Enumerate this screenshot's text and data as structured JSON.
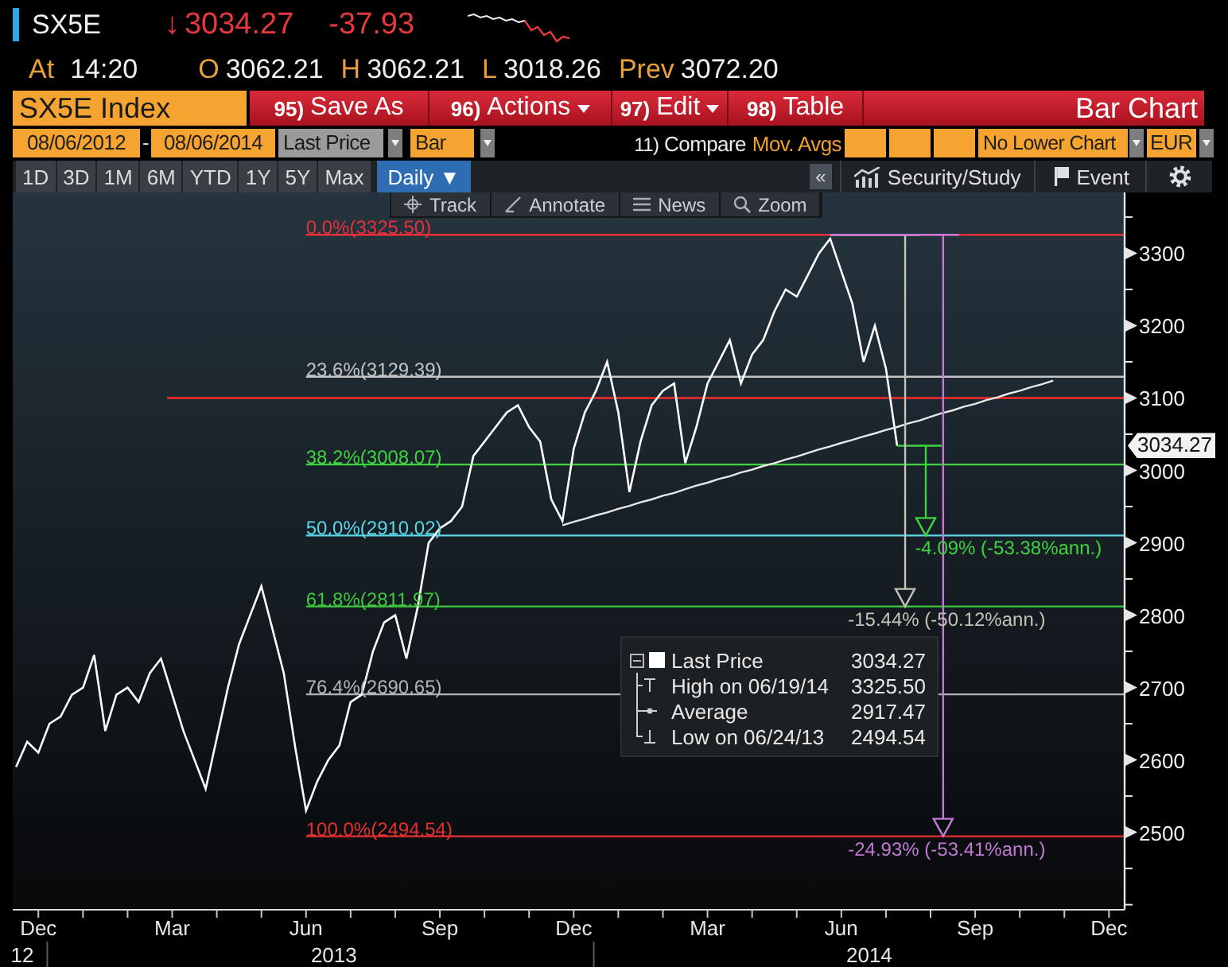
{
  "quote": {
    "ticker": "SX5E",
    "arrow": "↓",
    "last": "3034.27",
    "change": "-37.93",
    "fields": [
      {
        "label": "At",
        "value": "14:20"
      },
      {
        "label": "O",
        "value": "3062.21"
      },
      {
        "label": "H",
        "value": "3062.21"
      },
      {
        "label": "L",
        "value": "3018.26"
      },
      {
        "label": "Prev",
        "value": "3072.20"
      }
    ]
  },
  "menu_bar": {
    "security": "SX5E Index",
    "items": [
      {
        "number": "95)",
        "label": "Save As",
        "dropdown": false
      },
      {
        "number": "96)",
        "label": "Actions",
        "dropdown": true
      },
      {
        "number": "97)",
        "label": "Edit",
        "dropdown": true
      },
      {
        "number": "98)",
        "label": "Table",
        "dropdown": false
      }
    ],
    "view": "Bar Chart"
  },
  "settings_bar": {
    "start_date": "08/06/2012",
    "separator": "-",
    "end_date": "08/06/2014",
    "field": "Last Price",
    "style": "Bar",
    "compare": {
      "number": "11)",
      "label": "Compare"
    },
    "mov_avgs": "Mov. Avgs",
    "lower_chart": "No Lower Chart",
    "currency": "EUR"
  },
  "range_bar": {
    "periods": [
      {
        "label": "1D",
        "selected": false
      },
      {
        "label": "3D",
        "selected": false
      },
      {
        "label": "1M",
        "selected": false
      },
      {
        "label": "6M",
        "selected": false
      },
      {
        "label": "YTD",
        "selected": false
      },
      {
        "label": "1Y",
        "selected": false
      },
      {
        "label": "5Y",
        "selected": false
      },
      {
        "label": "Max",
        "selected": false
      }
    ],
    "frequency": {
      "label": "Daily",
      "caret": "▼"
    },
    "collapse": "«",
    "tools": [
      {
        "kind": "study",
        "label": "Security/Study"
      },
      {
        "kind": "event",
        "label": "Event"
      },
      {
        "kind": "settings"
      }
    ]
  },
  "chart_toolbar": [
    {
      "kind": "track",
      "label": "Track"
    },
    {
      "kind": "annotate",
      "label": "Annotate"
    },
    {
      "kind": "news",
      "label": "News"
    },
    {
      "kind": "zoom",
      "label": "Zoom"
    }
  ],
  "chart": {
    "chart_data": {
      "type": "line",
      "categories": [
        null,
        null,
        "Dec",
        null,
        null,
        null,
        null,
        null,
        null,
        null,
        null,
        null,
        null,
        null,
        "Mar",
        null,
        null,
        null,
        null,
        null,
        null,
        null,
        null,
        null,
        null,
        null,
        "Jun",
        null,
        null,
        null,
        null,
        null,
        null,
        null,
        null,
        null,
        null,
        null,
        "Sep",
        null,
        null,
        null,
        null,
        null,
        null,
        null,
        null,
        null,
        null,
        null,
        "Dec",
        null,
        null,
        null,
        null,
        null,
        null,
        null,
        null,
        null,
        null,
        null,
        "Mar",
        null,
        null,
        null,
        null,
        null,
        null,
        null,
        null,
        null,
        null,
        null,
        "Jun",
        null,
        null,
        null,
        null,
        null,
        null,
        null,
        null,
        null,
        null,
        null,
        "Sep",
        null,
        null,
        null,
        null,
        null,
        null,
        null,
        null,
        null,
        null,
        null,
        "Dec"
      ],
      "series": [
        {
          "name": "Last Price",
          "color": "#ffffff",
          "values": [
            2590,
            2625,
            2610,
            2650,
            2660,
            2690,
            2700,
            2745,
            2640,
            2690,
            2700,
            2680,
            2720,
            2740,
            2690,
            2640,
            2600,
            2560,
            2630,
            2700,
            2760,
            2800,
            2840,
            2780,
            2720,
            2620,
            2530,
            2570,
            2600,
            2620,
            2680,
            2690,
            2750,
            2790,
            2800,
            2740,
            2810,
            2900,
            2920,
            2930,
            2950,
            3020,
            3040,
            3060,
            3080,
            3090,
            3060,
            3040,
            2960,
            2930,
            3030,
            3080,
            3110,
            3150,
            3080,
            2970,
            3040,
            3090,
            3110,
            3120,
            3010,
            3060,
            3120,
            3150,
            3180,
            3120,
            3160,
            3180,
            3220,
            3250,
            3240,
            3270,
            3300,
            3320,
            3275,
            3230,
            3150,
            3200,
            3140,
            3034,
            null,
            null,
            null,
            null,
            null,
            null,
            null,
            null,
            null,
            null,
            null,
            null,
            null,
            null,
            null,
            null,
            null,
            null,
            null
          ]
        },
        {
          "color": "#e8e8e8",
          "values": [
            null,
            null,
            null,
            null,
            null,
            null,
            null,
            null,
            null,
            null,
            null,
            null,
            null,
            null,
            null,
            null,
            null,
            null,
            null,
            null,
            null,
            null,
            null,
            null,
            null,
            null,
            null,
            null,
            null,
            null,
            null,
            null,
            null,
            null,
            null,
            null,
            null,
            null,
            null,
            null,
            null,
            null,
            null,
            null,
            null,
            null,
            null,
            null,
            null,
            2924,
            2929,
            2933,
            2938,
            2942,
            2947,
            2951,
            2956,
            2960,
            2965,
            2969,
            2974,
            2979,
            2983,
            2988,
            2992,
            2997,
            3001,
            3006,
            3010,
            3015,
            3019,
            3024,
            3029,
            3033,
            3038,
            3042,
            3047,
            3051,
            3056,
            3060,
            3065,
            3069,
            3074,
            3079,
            3083,
            3088,
            3092,
            3097,
            3101,
            3106,
            3110,
            3115,
            3119,
            3124,
            null,
            null,
            null,
            null,
            null
          ]
        }
      ],
      "ylim": [
        2393,
        3384
      ],
      "yticks": [
        2500,
        2600,
        2700,
        2800,
        2900,
        3000,
        3100,
        3200,
        3300
      ],
      "ref_lines": [
        {
          "axis": "y",
          "value": 3325.5,
          "label": "0.0%(3325.50)",
          "color": "#e8303a"
        },
        {
          "axis": "y",
          "value": 3129.39,
          "label": "23.6%(3129.39)",
          "color": "#c4c4c4"
        },
        {
          "axis": "y",
          "value": 3008.07,
          "label": "38.2%(3008.07)",
          "color": "#3fd23f"
        },
        {
          "axis": "y",
          "value": 2910.02,
          "label": "50.0%(2910.02)",
          "color": "#5cd6e6"
        },
        {
          "axis": "y",
          "value": 2811.97,
          "label": "61.8%(2811.97)",
          "color": "#3ec83e"
        },
        {
          "axis": "y",
          "value": 2690.65,
          "label": "76.4%(2690.65)",
          "color": "#b4b4b4"
        },
        {
          "axis": "y",
          "value": 2494.54,
          "label": "100.0%(2494.54)",
          "color": "#e6302e"
        },
        {
          "axis": "y",
          "value": 3100,
          "color": "#d42a2a"
        }
      ],
      "annotations": [
        "-4.09% (-53.38%ann.)",
        "-15.44% (-50.12%ann.)",
        "-24.93% (-53.41%ann.)",
        "3034.27"
      ]
    },
    "x_axis_years": [
      "12",
      "2013",
      "2014"
    ]
  },
  "legend": [
    {
      "kind": "series",
      "value": "3034.27"
    },
    {
      "kind": "high",
      "label": "High on 06/19/14",
      "value": "3325.50"
    },
    {
      "kind": "average",
      "label": "Average",
      "value": "2917.47"
    },
    {
      "kind": "low",
      "label": "Low on 06/24/13",
      "value": "2494.54"
    }
  ]
}
